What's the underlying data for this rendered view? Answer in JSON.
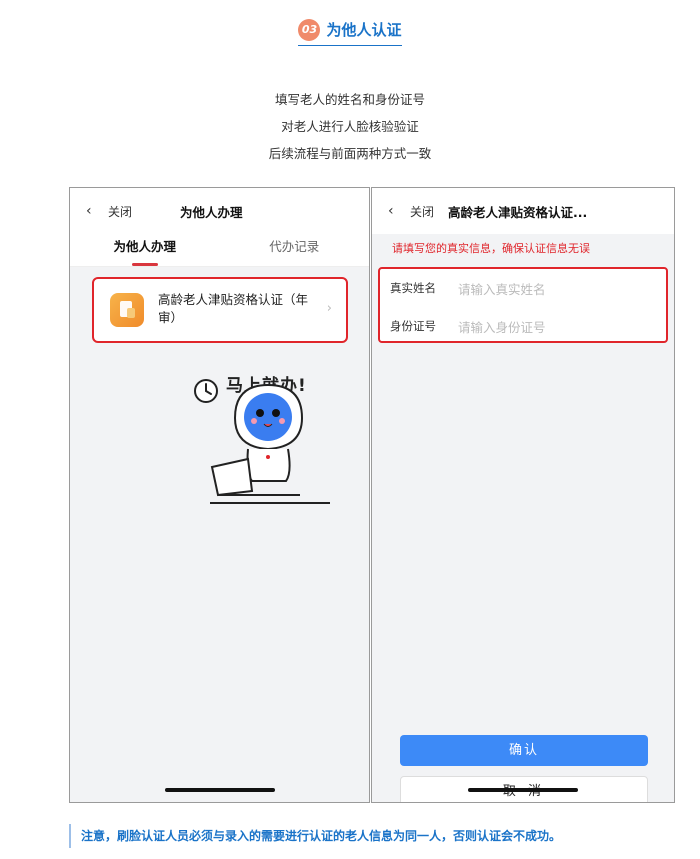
{
  "header": {
    "step_number": "03",
    "title": "为他人认证"
  },
  "description": [
    "填写老人的姓名和身份证号",
    "对老人进行人脸核验验证",
    "后续流程与前面两种方式一致"
  ],
  "left_phone": {
    "nav": {
      "back_icon": "chevron-left-icon",
      "close_label": "关闭",
      "title": "为他人办理"
    },
    "tabs": [
      {
        "label": "为他人办理",
        "active": true
      },
      {
        "label": "代办记录",
        "active": false
      }
    ],
    "service": {
      "name": "高龄老人津贴资格认证（年审）",
      "icon": "document-icon"
    },
    "slogan": "马上就办!"
  },
  "right_phone": {
    "nav": {
      "back_icon": "chevron-left-icon",
      "close_label": "关闭",
      "title": "高龄老人津贴资格认证..."
    },
    "warning": "请填写您的真实信息，确保认证信息无误",
    "form": {
      "name_label": "真实姓名",
      "name_placeholder": "请输入真实姓名",
      "id_label": "身份证号",
      "id_placeholder": "请输入身份证号"
    },
    "confirm_label": "确认",
    "cancel_label": "取 消"
  },
  "note": "注意，刷脸认证人员必须与录入的需要进行认证的老人信息为同一人，否则认证会不成功。",
  "colors": {
    "accent_blue": "#1a73c8",
    "highlight_red": "#e0252b",
    "button_blue": "#3d8af7"
  }
}
